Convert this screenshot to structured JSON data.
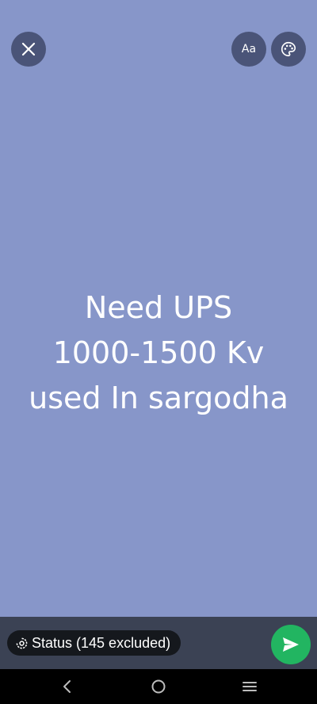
{
  "status": {
    "text": "Need UPS\n1000-1500 Kv\nused In sargodha"
  },
  "toolbar": {
    "close_icon": "close-icon",
    "font_label": "Aa",
    "palette_icon": "palette-icon"
  },
  "bottom": {
    "audience_label": "Status (145 excluded)",
    "audience_icon": "status-icon",
    "send_icon": "send-icon"
  },
  "navigation": {
    "back_icon": "back-icon",
    "home_icon": "home-icon",
    "recents_icon": "recents-icon"
  },
  "colors": {
    "background": "#8796c9",
    "send": "#22b561"
  }
}
